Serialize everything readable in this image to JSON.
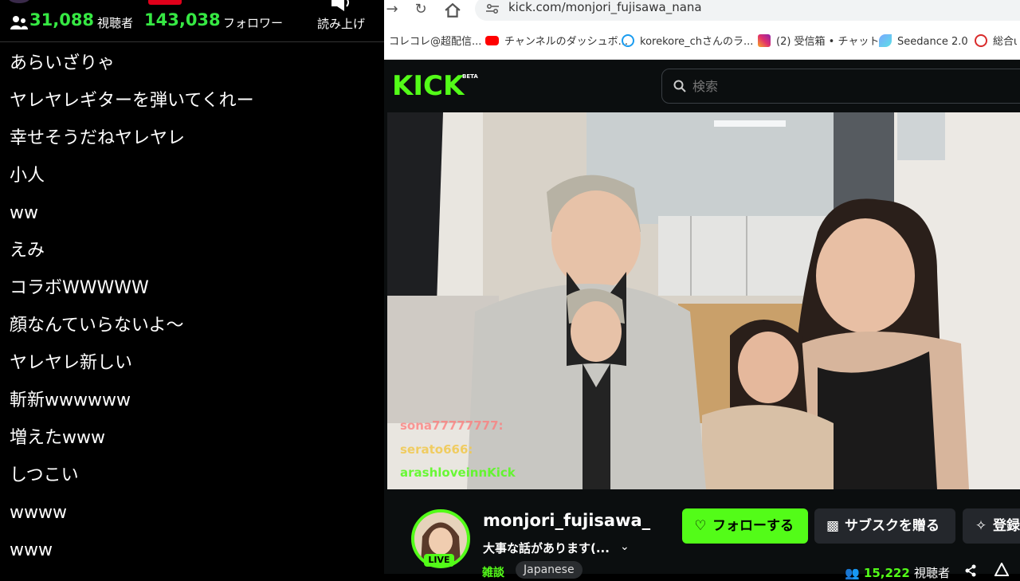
{
  "left_panel": {
    "viewers_count": "31,088",
    "viewers_label": "視聴者",
    "followers_count": "143,038",
    "followers_label": "フォロワー",
    "tts_label": "読み上げ",
    "comments": [
      "あらいざりゃ",
      "ヤレヤレギターを弾いてくれー",
      "幸せそうだねヤレヤレ",
      "小人",
      "ww",
      "えみ",
      "コラボWWWWW",
      "顔なんていらないよ〜",
      "ヤレヤレ新しい",
      "斬新wwwwww",
      "増えたwww",
      "しつこい",
      "wwww",
      "www"
    ]
  },
  "browser": {
    "url": "kick.com/monjori_fujisawa_nana",
    "bookmarks": [
      {
        "label": "コレコレ@超配信...",
        "icon": "folder-icon",
        "color": "#f5c542"
      },
      {
        "label": "チャンネルのダッシュボ...",
        "icon": "youtube-icon",
        "color": "#ff0000"
      },
      {
        "label": "korekore_chさんのラ...",
        "icon": "kick-swirl-icon",
        "color": "#1a9cf0"
      },
      {
        "label": "(2) 受信箱 • チャット",
        "icon": "instagram-icon",
        "color": "#e1306c"
      },
      {
        "label": "Seedance 2.0",
        "icon": "seedance-icon",
        "color": "#7aa7ff"
      },
      {
        "label": "総合ι",
        "icon": "crown-icon",
        "color": "#d92b2b"
      }
    ]
  },
  "kick": {
    "logo_text": "KICK",
    "beta_label": "BETA",
    "search_placeholder": "検索",
    "video_overlay_chat": [
      {
        "text": "sona77777777:",
        "color": "#ff7a7a"
      },
      {
        "text": "serato666:",
        "color": "#f2c84b"
      },
      {
        "text": "arashloveinnKick",
        "color": "#53fc18"
      }
    ],
    "channel": {
      "name": "monjori_fujisawa_",
      "live_label": "LIVE",
      "stream_title": "大事な話があります(...",
      "category": "雑談",
      "language": "Japanese",
      "viewer_count": "15,222",
      "viewer_label": "視聴者"
    },
    "buttons": {
      "follow": "フォローする",
      "gift_sub": "サブスクを贈る",
      "login": "登録"
    },
    "accent_color": "#53fc18"
  }
}
